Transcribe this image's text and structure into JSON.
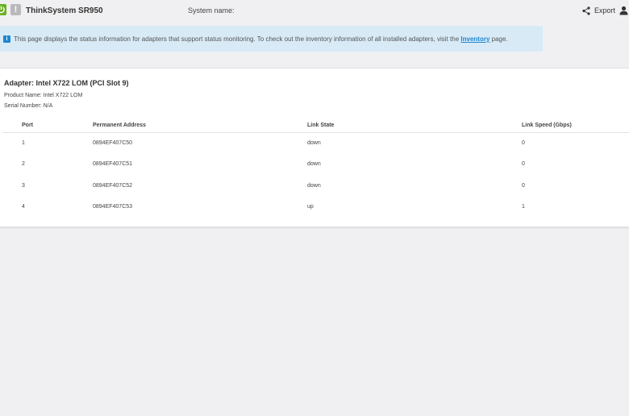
{
  "header": {
    "product": "ThinkSystem SR950",
    "system_name_label": "System name:",
    "export_label": "Export",
    "icons": {
      "power": "power-icon",
      "warning": "warning-icon",
      "share": "share-icon",
      "user": "user-icon"
    },
    "colors": {
      "power": "#6ab023",
      "accent": "#1f86cf"
    }
  },
  "banner": {
    "text": "This page displays the status information for adapters that support status monitoring. To check out the inventory information of all installed adapters, visit the",
    "link": "Inventory",
    "suffix": "page."
  },
  "adapter": {
    "title": "Adapter: Intel X722 LOM (PCI Slot 9)",
    "product_name": "Product Name: Intel X722 LOM",
    "serial_number": "Serial Number: N/A"
  },
  "table": {
    "columns": [
      "Port",
      "Permanent Address",
      "Link State",
      "Link Speed (Gbps)"
    ],
    "rows": [
      [
        "1",
        "0894EF407C50",
        "down",
        "0"
      ],
      [
        "2",
        "0894EF407C51",
        "down",
        "0"
      ],
      [
        "3",
        "0894EF407C52",
        "down",
        "0"
      ],
      [
        "4",
        "0894EF407C53",
        "up",
        "1"
      ]
    ]
  }
}
